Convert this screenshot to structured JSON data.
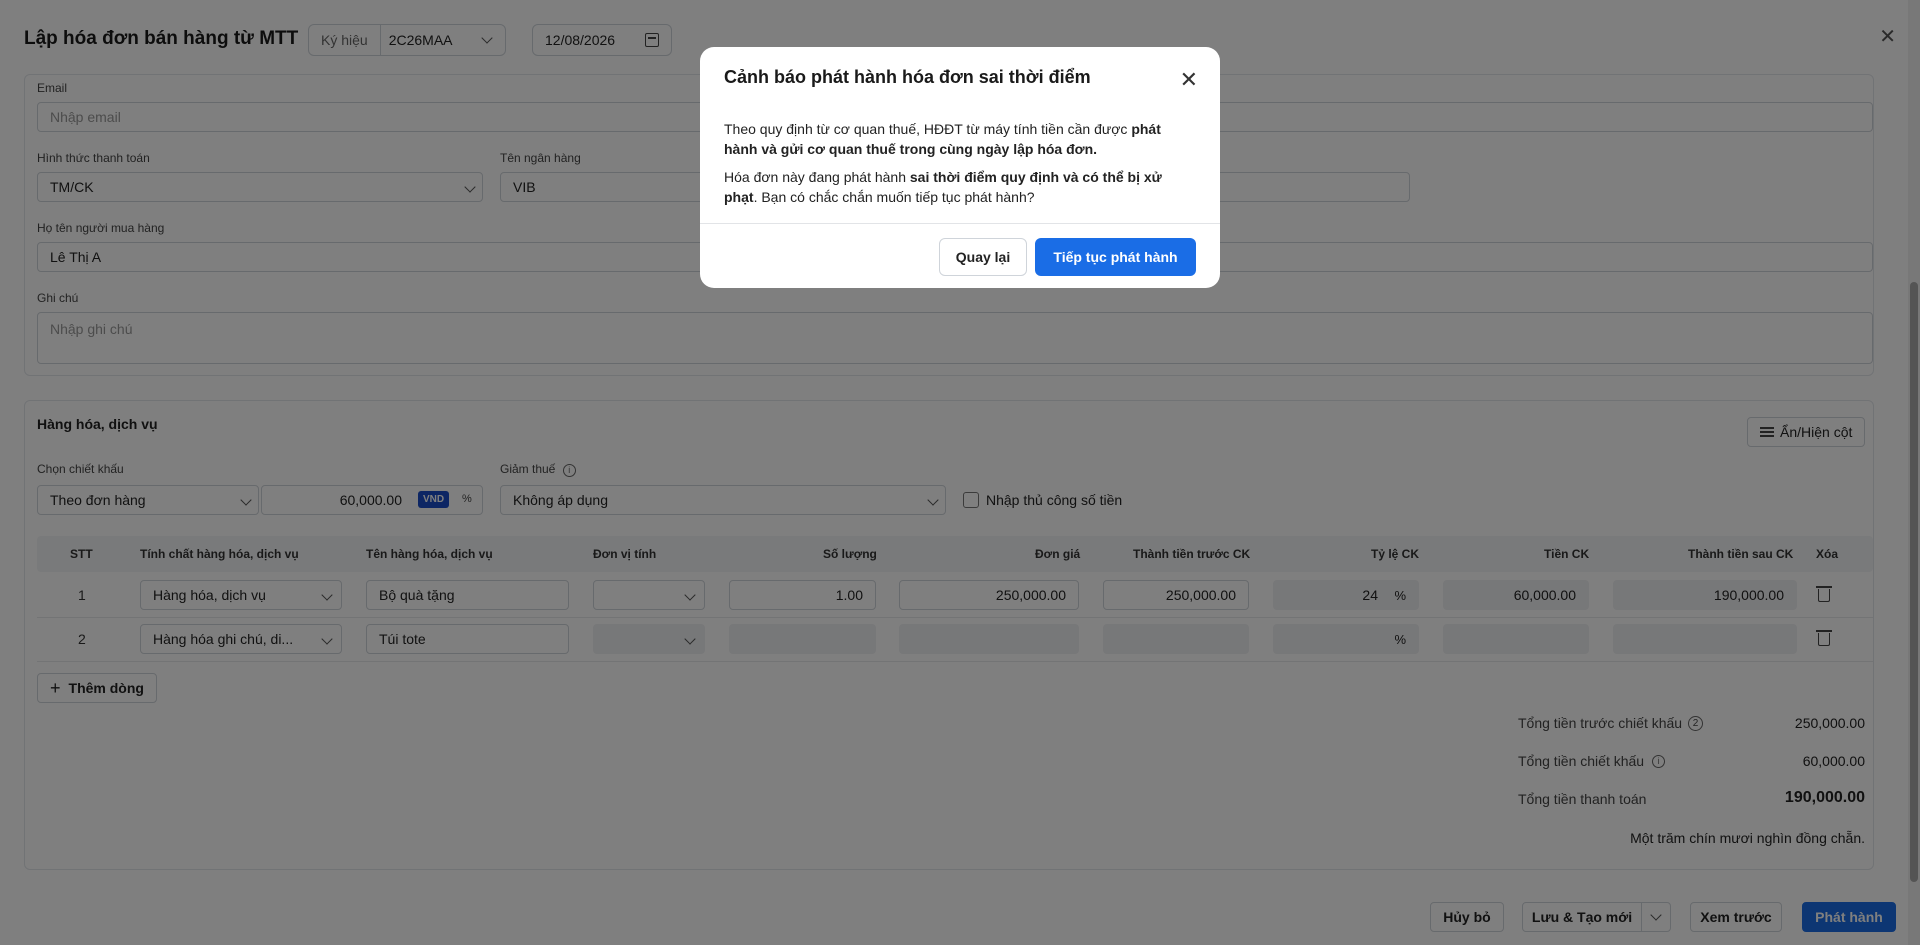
{
  "header": {
    "title": "Lập hóa đơn bán hàng từ MTT",
    "symbol_label": "Ký hiệu",
    "symbol_value": "2C26MAA",
    "date_value": "12/08/2026",
    "close_glyph": "✕"
  },
  "customer": {
    "email_label": "Email",
    "email_placeholder": "Nhập email",
    "payment_label": "Hình thức thanh toán",
    "payment_value": "TM/CK",
    "bank_label": "Tên ngân hàng",
    "bank_value": "VIB",
    "buyer_label": "Họ tên người mua hàng",
    "buyer_value": "Lê Thị A",
    "note_label": "Ghi chú",
    "note_placeholder": "Nhập ghi chú"
  },
  "goods": {
    "section_title": "Hàng hóa, dịch vụ",
    "toggle_columns_label": "Ẩn/Hiện cột",
    "discount_label": "Chọn chiết khấu",
    "discount_type": "Theo đơn hàng",
    "discount_amount": "60,000.00",
    "discount_unit_vnd": "VND",
    "discount_unit_pct": "%",
    "tax_reduction_label": "Giảm thuế",
    "tax_reduction_value": "Không áp dụng",
    "manual_amount_label": "Nhập thủ công số tiền"
  },
  "table": {
    "headers": [
      "STT",
      "Tính chất hàng hóa, dịch vụ",
      "Tên hàng hóa, dịch vụ",
      "Đơn vị tính",
      "Số lượng",
      "Đơn giá",
      "Thành tiền trước CK",
      "Tỷ lệ CK",
      "Tiền CK",
      "Thành tiền sau CK",
      "Xóa"
    ],
    "rows": [
      {
        "stt": "1",
        "type": "Hàng hóa, dịch vụ",
        "name": "Bộ quà tặng",
        "unit": "",
        "qty": "1.00",
        "price": "250,000.00",
        "before": "250,000.00",
        "rate": "24",
        "pct": "%",
        "disc": "60,000.00",
        "after": "190,000.00"
      },
      {
        "stt": "2",
        "type": "Hàng hóa ghi chú, di...",
        "name": "Túi tote",
        "unit": "",
        "qty": "",
        "price": "",
        "before": "",
        "rate": "",
        "pct": "%",
        "disc": "",
        "after": ""
      }
    ],
    "add_row_label": "Thêm dòng"
  },
  "summary": {
    "subtotal_label": "Tổng tiền trước chiết khấu",
    "subtotal_value": "250,000.00",
    "discount_label": "Tổng tiền chiết khấu",
    "discount_value": "60,000.00",
    "total_label": "Tổng tiền thanh toán",
    "total_value": "190,000.00",
    "in_words": "Một trăm chín mươi nghìn đồng chẵn."
  },
  "footer": {
    "cancel": "Hủy bỏ",
    "save_new": "Lưu & Tạo mới",
    "preview": "Xem trước",
    "issue": "Phát hành"
  },
  "modal": {
    "title": "Cảnh báo phát hành hóa đơn sai thời điểm",
    "p1_a": "Theo quy định từ cơ quan thuế, HĐĐT từ máy tính tiền cần được ",
    "p1_b": "phát hành và gửi cơ quan thuế trong cùng ngày lập hóa đơn.",
    "p2_a": "Hóa đơn này đang phát hành ",
    "p2_b": "sai thời điểm quy định và có thể bị xử phạt",
    "p2_c": ". Bạn có chắc chắn muốn tiếp tục phát hành?",
    "back": "Quay lại",
    "continue": "Tiếp tục phát hành"
  }
}
